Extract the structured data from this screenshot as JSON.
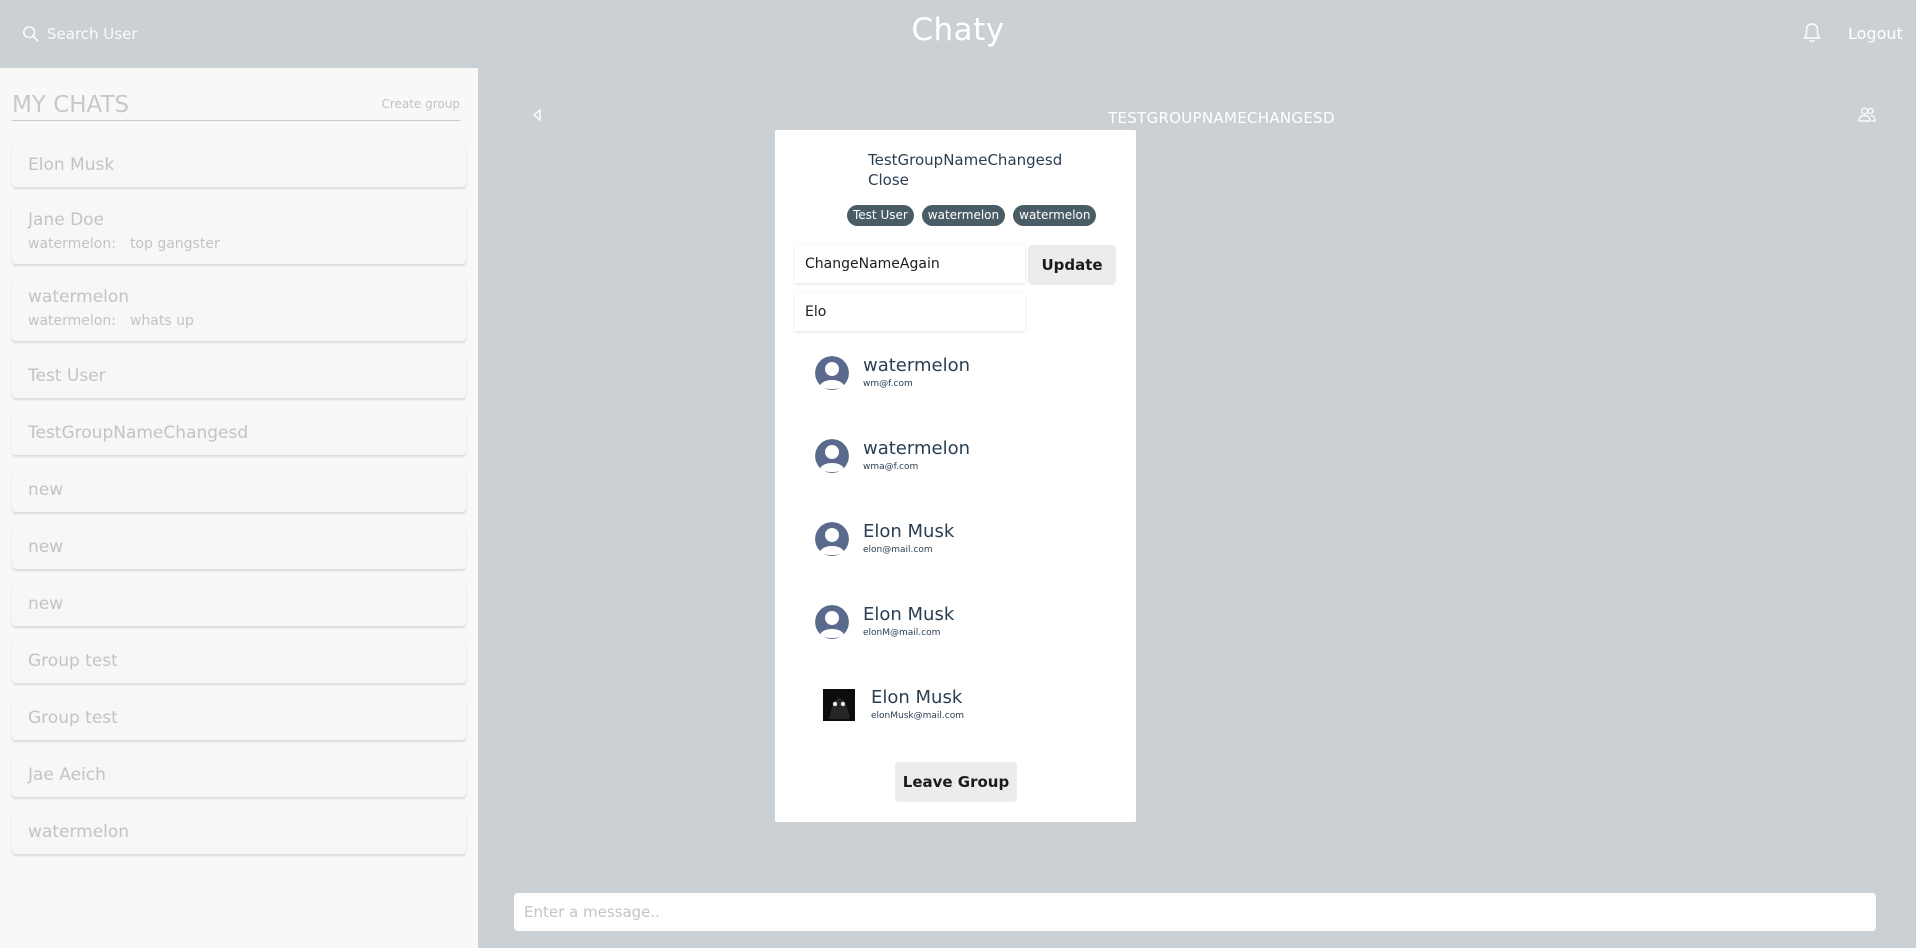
{
  "header": {
    "search_label": "Search User",
    "app_title": "Chaty",
    "logout_label": "Logout"
  },
  "sidebar": {
    "title": "MY CHATS",
    "create_group_label": "Create group",
    "chats": [
      {
        "name": "Elon Musk",
        "sender": "",
        "message": ""
      },
      {
        "name": "Jane Doe",
        "sender": "watermelon:",
        "message": "top gangster"
      },
      {
        "name": "watermelon",
        "sender": "watermelon:",
        "message": "whats up"
      },
      {
        "name": "Test User",
        "sender": "",
        "message": ""
      },
      {
        "name": "TestGroupNameChangesd",
        "sender": "",
        "message": ""
      },
      {
        "name": "new",
        "sender": "",
        "message": ""
      },
      {
        "name": "new",
        "sender": "",
        "message": ""
      },
      {
        "name": "new",
        "sender": "",
        "message": ""
      },
      {
        "name": "Group test",
        "sender": "",
        "message": ""
      },
      {
        "name": "Group test",
        "sender": "",
        "message": ""
      },
      {
        "name": "Jae Aeich",
        "sender": "",
        "message": ""
      },
      {
        "name": "watermelon",
        "sender": "",
        "message": ""
      }
    ]
  },
  "main": {
    "chat_title": "TestGroupNameChangesd",
    "message_placeholder": "Enter a message.."
  },
  "modal": {
    "title": "TestGroupNameChangesd",
    "close_label": "Close",
    "members": [
      "Test User",
      "watermelon",
      "watermelon"
    ],
    "group_name_value": "ChangeNameAgain",
    "update_label": "Update",
    "user_search_value": "Elo",
    "results": [
      {
        "name": "watermelon",
        "email": "wm@f.com",
        "avatar": "default"
      },
      {
        "name": "watermelon",
        "email": "wma@f.com",
        "avatar": "default"
      },
      {
        "name": "Elon Musk",
        "email": "elon@mail.com",
        "avatar": "default"
      },
      {
        "name": "Elon Musk",
        "email": "elonM@mail.com",
        "avatar": "default"
      },
      {
        "name": "Elon Musk",
        "email": "elonMusk@mail.com",
        "avatar": "photo"
      }
    ],
    "leave_label": "Leave Group"
  },
  "colors": {
    "background": "#cbd0d5",
    "sidebar": "#f8f8f7",
    "badge": "#4a5d66",
    "modal_text": "#2a3f52",
    "avatar": "#5a6a8c"
  }
}
